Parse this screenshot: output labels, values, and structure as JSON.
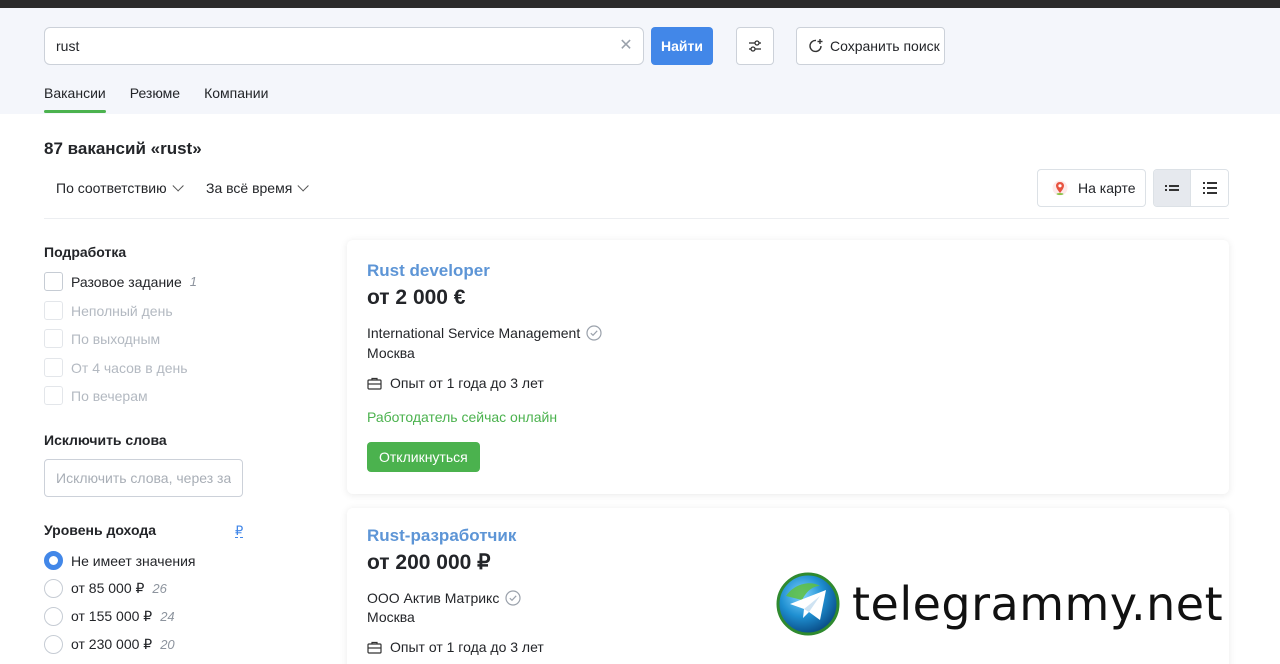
{
  "search": {
    "value": "rust",
    "find_label": "Найти",
    "save_label": "Сохранить поиск"
  },
  "tabs": [
    {
      "label": "Вакансии",
      "active": true
    },
    {
      "label": "Резюме",
      "active": false
    },
    {
      "label": "Компании",
      "active": false
    }
  ],
  "results": {
    "title": "87 вакансий «rust»",
    "sort_label": "По соответствию",
    "period_label": "За всё время",
    "map_label": "На карте"
  },
  "sidebar": {
    "parttime": {
      "title": "Подработка",
      "options": [
        {
          "label": "Разовое задание",
          "count": "1",
          "disabled": false
        },
        {
          "label": "Неполный день",
          "count": "",
          "disabled": true
        },
        {
          "label": "По выходным",
          "count": "",
          "disabled": true
        },
        {
          "label": "От 4 часов в день",
          "count": "",
          "disabled": true
        },
        {
          "label": "По вечерам",
          "count": "",
          "disabled": true
        }
      ]
    },
    "exclude": {
      "title": "Исключить слова",
      "placeholder": "Исключить слова, через запятую"
    },
    "income": {
      "title": "Уровень дохода",
      "currency": "₽",
      "options": [
        {
          "label": "Не имеет значения",
          "count": "",
          "checked": true
        },
        {
          "label": "от 85 000 ₽",
          "count": "26",
          "checked": false
        },
        {
          "label": "от 155 000 ₽",
          "count": "24",
          "checked": false
        },
        {
          "label": "от 230 000 ₽",
          "count": "20",
          "checked": false
        }
      ]
    }
  },
  "vacancies": [
    {
      "title": "Rust developer",
      "salary": "от 2 000 €",
      "company": "International Service Management",
      "city": "Москва",
      "experience": "Опыт от 1 года до 3 лет",
      "online": "Работодатель сейчас онлайн",
      "apply_label": "Откликнуться"
    },
    {
      "title": "Rust-разработчик",
      "salary": "от 200 000 ₽",
      "company": "ООО Актив Матрикс",
      "city": "Москва",
      "experience": "Опыт от 1 года до 3 лет"
    }
  ],
  "watermark": {
    "text": "telegrammy.net"
  },
  "colors": {
    "accent_blue": "#4287e8",
    "green": "#4bb24e",
    "link": "#5d95d6"
  }
}
